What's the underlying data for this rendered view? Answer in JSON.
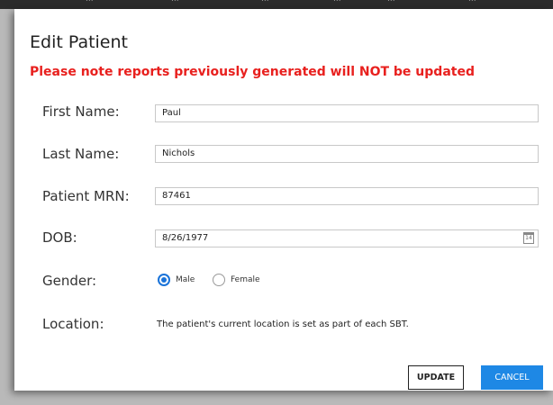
{
  "backdrop": {
    "columns": [
      "...",
      "...",
      "...",
      "...",
      "...",
      "..."
    ]
  },
  "dialog": {
    "title": "Edit Patient",
    "warning": "Please note reports previously generated will NOT be updated",
    "fields": {
      "first_name": {
        "label": "First Name:",
        "value": "Paul"
      },
      "last_name": {
        "label": "Last Name:",
        "value": "Nichols"
      },
      "mrn": {
        "label": "Patient MRN:",
        "value": "87461"
      },
      "dob": {
        "label": "DOB:",
        "value": "8/26/1977",
        "calendar_day": "14"
      },
      "gender": {
        "label": "Gender:",
        "options": [
          "Male",
          "Female"
        ],
        "selected": "Male"
      },
      "location": {
        "label": "Location:",
        "text": "The patient's current location is set as part of each SBT."
      }
    },
    "buttons": {
      "update": "UPDATE",
      "cancel": "CANCEL"
    },
    "colors": {
      "warning": "#e8201e",
      "accent": "#1e88e5"
    }
  }
}
